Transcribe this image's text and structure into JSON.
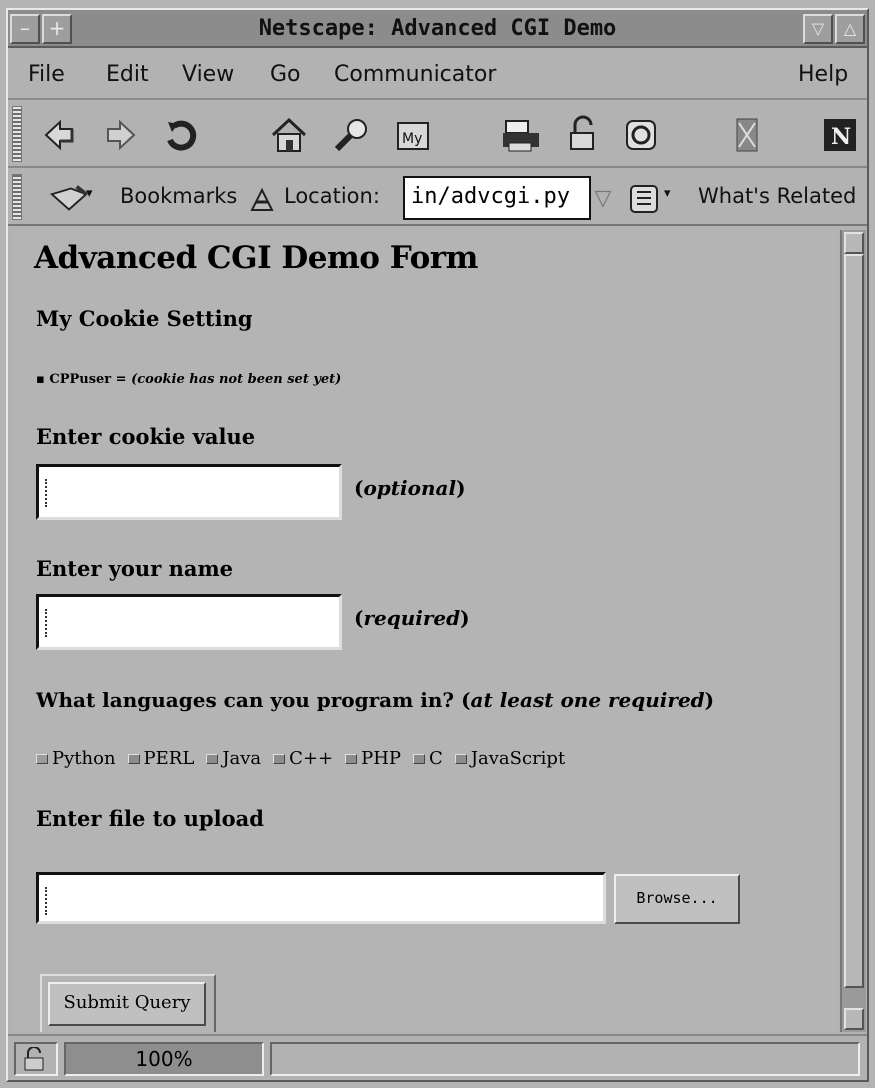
{
  "window": {
    "title": "Netscape: Advanced CGI Demo"
  },
  "menu": {
    "items": [
      "File",
      "Edit",
      "View",
      "Go",
      "Communicator"
    ],
    "help": "Help"
  },
  "toolbar": {
    "icons": [
      "back-icon",
      "forward-icon",
      "reload-icon",
      "home-icon",
      "search-icon",
      "my-netscape-icon",
      "print-icon",
      "security-icon",
      "shop-icon",
      "stop-icon",
      "netscape-logo"
    ],
    "my_label": "My"
  },
  "location": {
    "bookmarks_label": "Bookmarks",
    "location_label": "Location:",
    "url": "in/advcgi.py",
    "related_label": "What's Related"
  },
  "page": {
    "title": "Advanced CGI Demo Form",
    "cookie_heading": "My Cookie Setting",
    "cookie_name": "CPPuser",
    "cookie_sep": " = ",
    "cookie_status": "(cookie has not been set yet)",
    "cookie_value_label": "Enter cookie value",
    "cookie_value": "",
    "optional_open": "(",
    "optional_text": "optional",
    "optional_close": ")",
    "name_label": "Enter your name",
    "name_value": "",
    "required_open": "(",
    "required_text": "required",
    "required_close": ")",
    "languages_label": "What languages can you program in?",
    "languages_note_open": "(",
    "languages_note": "at least one required",
    "languages_note_close": ")",
    "languages": [
      "Python",
      "PERL",
      "Java",
      "C++",
      "PHP",
      "C",
      "JavaScript"
    ],
    "upload_label": "Enter file to upload",
    "upload_value": "",
    "browse_label": "Browse...",
    "submit_label": "Submit Query"
  },
  "status": {
    "progress": "100%",
    "message": ""
  }
}
